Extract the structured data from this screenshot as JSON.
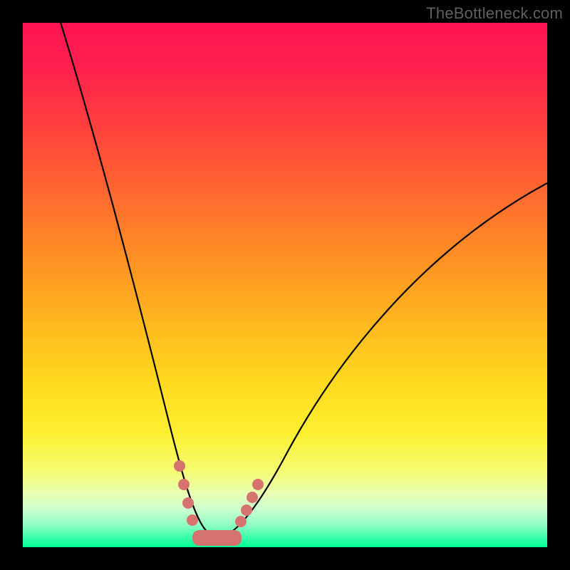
{
  "watermark": "TheBottleneck.com",
  "colors": {
    "background": "#000000",
    "curve_stroke": "#000000",
    "marker_fill": "#d6736f",
    "ideal_fill": "#d6736f"
  },
  "chart_data": {
    "type": "line",
    "title": "",
    "xlabel": "",
    "ylabel": "",
    "xlim": [
      0,
      100
    ],
    "ylim": [
      0,
      100
    ],
    "series": [
      {
        "name": "bottleneck-curve",
        "x": [
          5,
          10,
          15,
          20,
          25,
          28,
          30,
          32,
          34,
          36,
          38,
          40,
          45,
          50,
          55,
          60,
          65,
          70,
          75,
          80,
          85,
          90,
          95,
          100
        ],
        "y": [
          100,
          80,
          60,
          42,
          26,
          17,
          12,
          8,
          5,
          3,
          2,
          3,
          7,
          12,
          18,
          24,
          30,
          36,
          41,
          46,
          51,
          55,
          58,
          60
        ]
      }
    ],
    "ideal_region": {
      "x": [
        30,
        42
      ],
      "fill": "#d6736f"
    },
    "markers": {
      "name": "highlight-dots",
      "points": [
        {
          "x": 29,
          "y": 13
        },
        {
          "x": 30,
          "y": 10
        },
        {
          "x": 31,
          "y": 7
        },
        {
          "x": 32,
          "y": 5
        },
        {
          "x": 41,
          "y": 4
        },
        {
          "x": 42,
          "y": 6
        },
        {
          "x": 43,
          "y": 8
        },
        {
          "x": 44,
          "y": 10
        }
      ]
    }
  }
}
